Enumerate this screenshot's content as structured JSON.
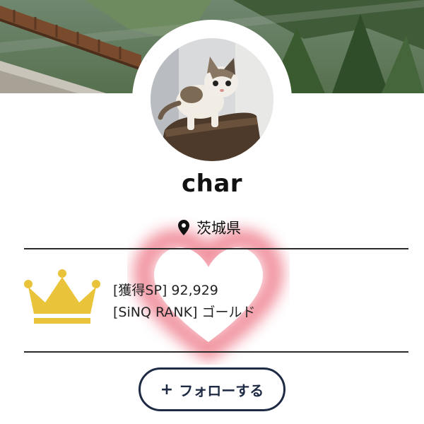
{
  "profile": {
    "username": "char",
    "location": "茨城県"
  },
  "stats": {
    "points_label": "[獲得SP]",
    "points_value": "92,929",
    "rank_label": "[SiNQ RANK]",
    "rank_value": "ゴールド"
  },
  "actions": {
    "follow_icon": "+",
    "follow_label": "フォローする"
  },
  "icons": {
    "location": "map-pin-icon",
    "rank": "crown-icon",
    "decoration": "heart-icon"
  },
  "colors": {
    "crown": "#e9c33a",
    "button_border": "#1f2a44",
    "heart_glow": "#e5394f"
  }
}
